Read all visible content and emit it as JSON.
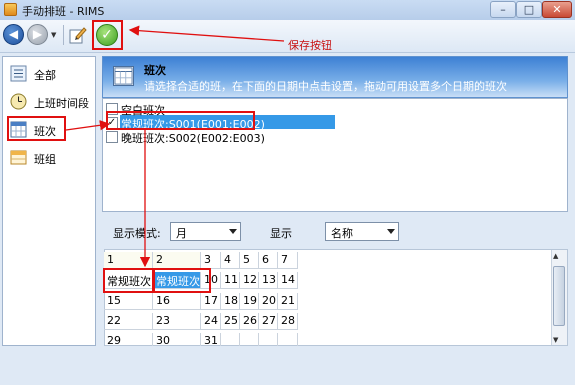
{
  "window": {
    "title": "手动排班 - RIMS"
  },
  "toolbar": {
    "save_note": "保存按钮"
  },
  "sidebar": {
    "items": [
      {
        "label": "全部"
      },
      {
        "label": "上班时间段"
      },
      {
        "label": "班次"
      },
      {
        "label": "班组"
      }
    ]
  },
  "header": {
    "title": "班次",
    "description": "请选择合适的班，在下面的日期中点击设置，拖动可用设置多个日期的班次"
  },
  "shifts": [
    {
      "label": "空白班次",
      "checked": false
    },
    {
      "label": "常规班次:S001(E001:E002)",
      "checked": true
    },
    {
      "label": "晚班班次:S002(E002:E003)",
      "checked": false
    }
  ],
  "controls": {
    "mode_label": "显示模式:",
    "mode_value": "月",
    "display_label": "显示",
    "display_value": "名称"
  },
  "calendar": {
    "rows": [
      [
        "1",
        "2",
        "3",
        "4",
        "5",
        "6",
        "7"
      ],
      [
        "常规班次",
        "常规班次",
        "10",
        "11",
        "12",
        "13",
        "14"
      ],
      [
        "15",
        "16",
        "17",
        "18",
        "19",
        "20",
        "21"
      ],
      [
        "22",
        "23",
        "24",
        "25",
        "26",
        "27",
        "28"
      ],
      [
        "29",
        "30",
        "31",
        "",
        "",
        "",
        ""
      ]
    ]
  },
  "colors": {
    "selection": "#3599e7",
    "annotation": "#e01010",
    "header": "#3d80d4"
  },
  "icons": [
    "back-icon",
    "forward-icon",
    "edit-icon",
    "checkmark-icon",
    "clock-icon",
    "calendar-icon",
    "group-icon"
  ]
}
